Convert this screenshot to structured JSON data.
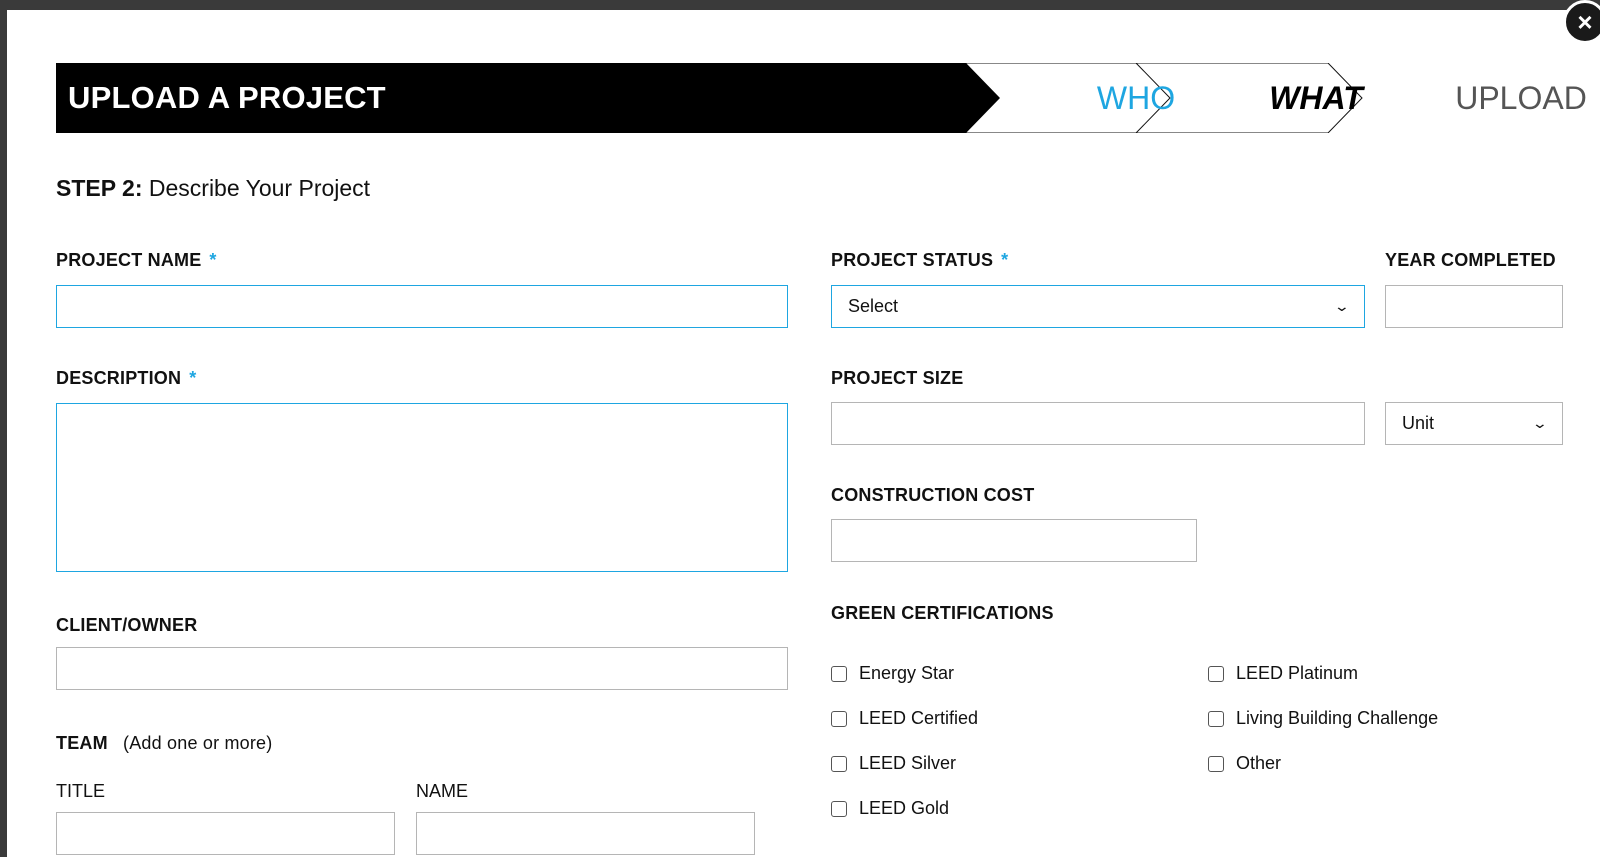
{
  "header": {
    "title": "UPLOAD A PROJECT",
    "steps": [
      {
        "label": "WHO",
        "state": "completed"
      },
      {
        "label": "WHAT",
        "state": "active"
      },
      {
        "label": "UPLOAD",
        "state": "upcoming"
      }
    ]
  },
  "close_icon": "×",
  "step": {
    "prefix": "STEP 2:",
    "title": "Describe Your Project"
  },
  "form": {
    "project_name": {
      "label": "PROJECT NAME",
      "required": "*",
      "value": ""
    },
    "description": {
      "label": "DESCRIPTION",
      "required": "*",
      "value": ""
    },
    "client_owner": {
      "label": "CLIENT/OWNER",
      "value": ""
    },
    "team": {
      "label": "TEAM",
      "hint": "(Add one or more)",
      "title_label": "TITLE",
      "name_label": "NAME",
      "title_value": "",
      "name_value": ""
    },
    "project_status": {
      "label": "PROJECT STATUS",
      "required": "*",
      "selected": "Select"
    },
    "year_completed": {
      "label": "YEAR COMPLETED",
      "value": ""
    },
    "project_size": {
      "label": "PROJECT SIZE",
      "value": "",
      "unit_selected": "Unit"
    },
    "construction_cost": {
      "label": "CONSTRUCTION COST",
      "value": ""
    },
    "green_certifications": {
      "label": "GREEN CERTIFICATIONS",
      "options": [
        {
          "label": "Energy Star",
          "checked": false
        },
        {
          "label": "LEED Certified",
          "checked": false
        },
        {
          "label": "LEED Silver",
          "checked": false
        },
        {
          "label": "LEED Gold",
          "checked": false
        },
        {
          "label": "LEED Platinum",
          "checked": false
        },
        {
          "label": "Living Building Challenge",
          "checked": false
        },
        {
          "label": "Other",
          "checked": false
        }
      ]
    }
  },
  "colors": {
    "accent": "#1ea6e1",
    "header_bg": "#000000",
    "upcoming_bg": "#efefef"
  }
}
